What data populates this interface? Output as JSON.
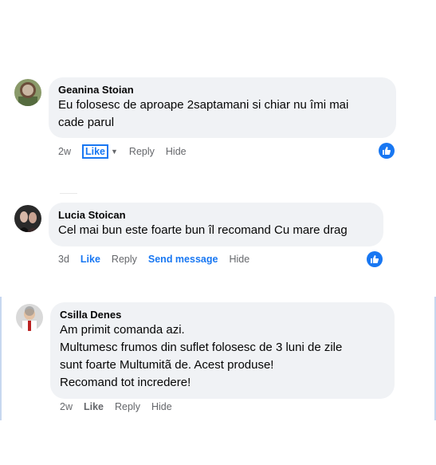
{
  "comments": [
    {
      "author": "Geanina Stoian",
      "lines": [
        "Eu folosesc de aproape 2saptamani si chiar nu îmi mai",
        "cade parul"
      ],
      "time": "2w",
      "like_label": "Like",
      "reply_label": "Reply",
      "hide_label": "Hide"
    },
    {
      "author": "Lucia Stoican",
      "lines": [
        "Cel mai bun este foarte bun îl recomand Cu mare drag"
      ],
      "time": "3d",
      "like_label": "Like",
      "reply_label": "Reply",
      "send_label": "Send message",
      "hide_label": "Hide"
    },
    {
      "author": "Csilla Denes",
      "lines": [
        "Am primit comanda azi.",
        "Multumesc frumos din suflet folosesc de 3 luni de zile",
        "sunt foarte Multumitã de. Acest produse!",
        "Recomand tot incredere!"
      ],
      "time": "2w",
      "like_label": "Like",
      "reply_label": "Reply",
      "hide_label": "Hide"
    }
  ],
  "colors": {
    "accent": "#1877f2",
    "bubble": "#f0f2f5",
    "meta": "#65676b"
  },
  "icons": {
    "reaction": "thumbs-up-icon",
    "caret": "caret-down-icon"
  }
}
